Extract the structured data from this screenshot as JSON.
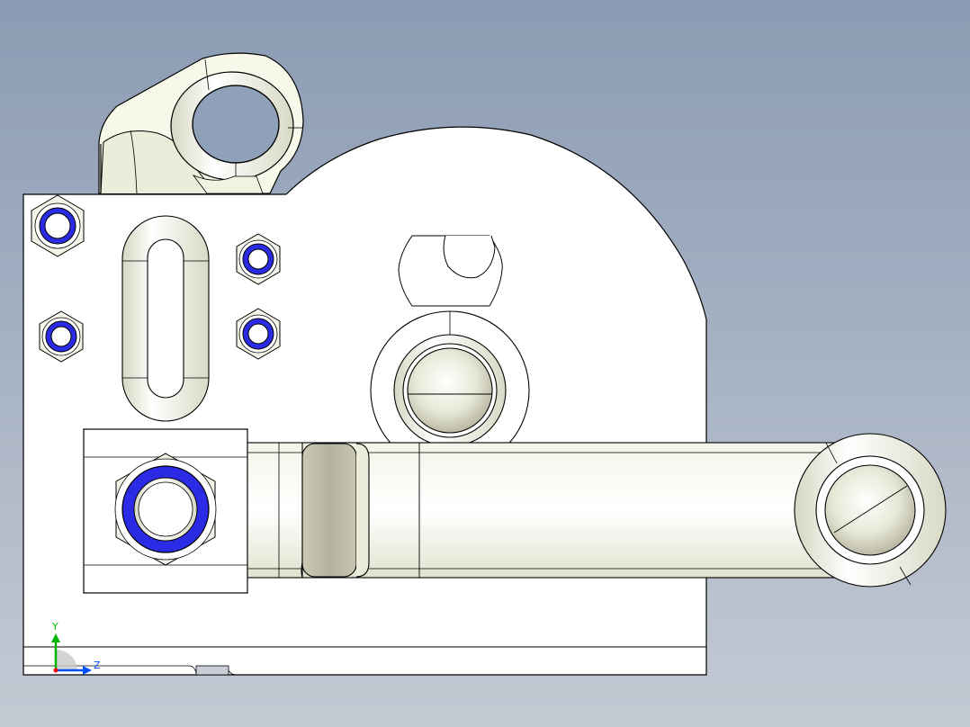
{
  "viewport": {
    "background_top": "#8a9bb3",
    "background_bottom": "#c4cad4"
  },
  "colors": {
    "part_face": "#ffffff",
    "part_shade": "#e4e4d2",
    "edge": "#000000",
    "nut_ring": "#2b2be6",
    "pad_shade": "#b4b49e",
    "axis_y": "#00b400",
    "axis_z": "#0050ff",
    "axis_x": "#ff0000"
  },
  "triad": {
    "y_label": "Y",
    "z_label": "Z"
  },
  "icons": [
    "coordinate-triad-icon"
  ]
}
